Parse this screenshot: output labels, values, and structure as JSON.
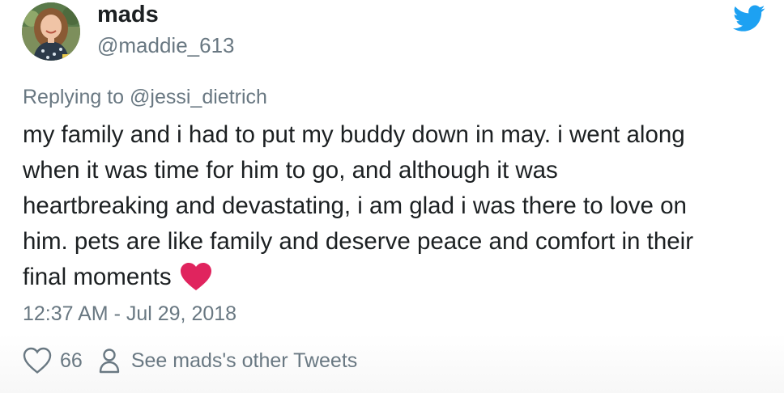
{
  "author": {
    "display_name": "mads",
    "handle": "@maddie_613"
  },
  "reply": {
    "prefix": "Replying to ",
    "mention": "@jessi_dietrich"
  },
  "tweet": {
    "lines": [
      "my family and i had to put my buddy down in may. i went along",
      "when it was time for him to go, and although it was",
      "heartbreaking and devastating, i am glad i was there to love on",
      "him. pets are like family and deserve peace and comfort in their",
      "final moments"
    ],
    "emoji": "red-heart-emoji"
  },
  "timestamp": "12:37 AM - Jul 29, 2018",
  "actions": {
    "like_count": "66",
    "other_tweets_label": "See mads's other Tweets"
  },
  "colors": {
    "twitter_blue": "#1da1f2",
    "secondary_text": "#697882",
    "heart_red": "#e0245e"
  },
  "icons": {
    "brand": "twitter-bird-icon",
    "like": "heart-outline-icon",
    "profile": "person-icon"
  }
}
